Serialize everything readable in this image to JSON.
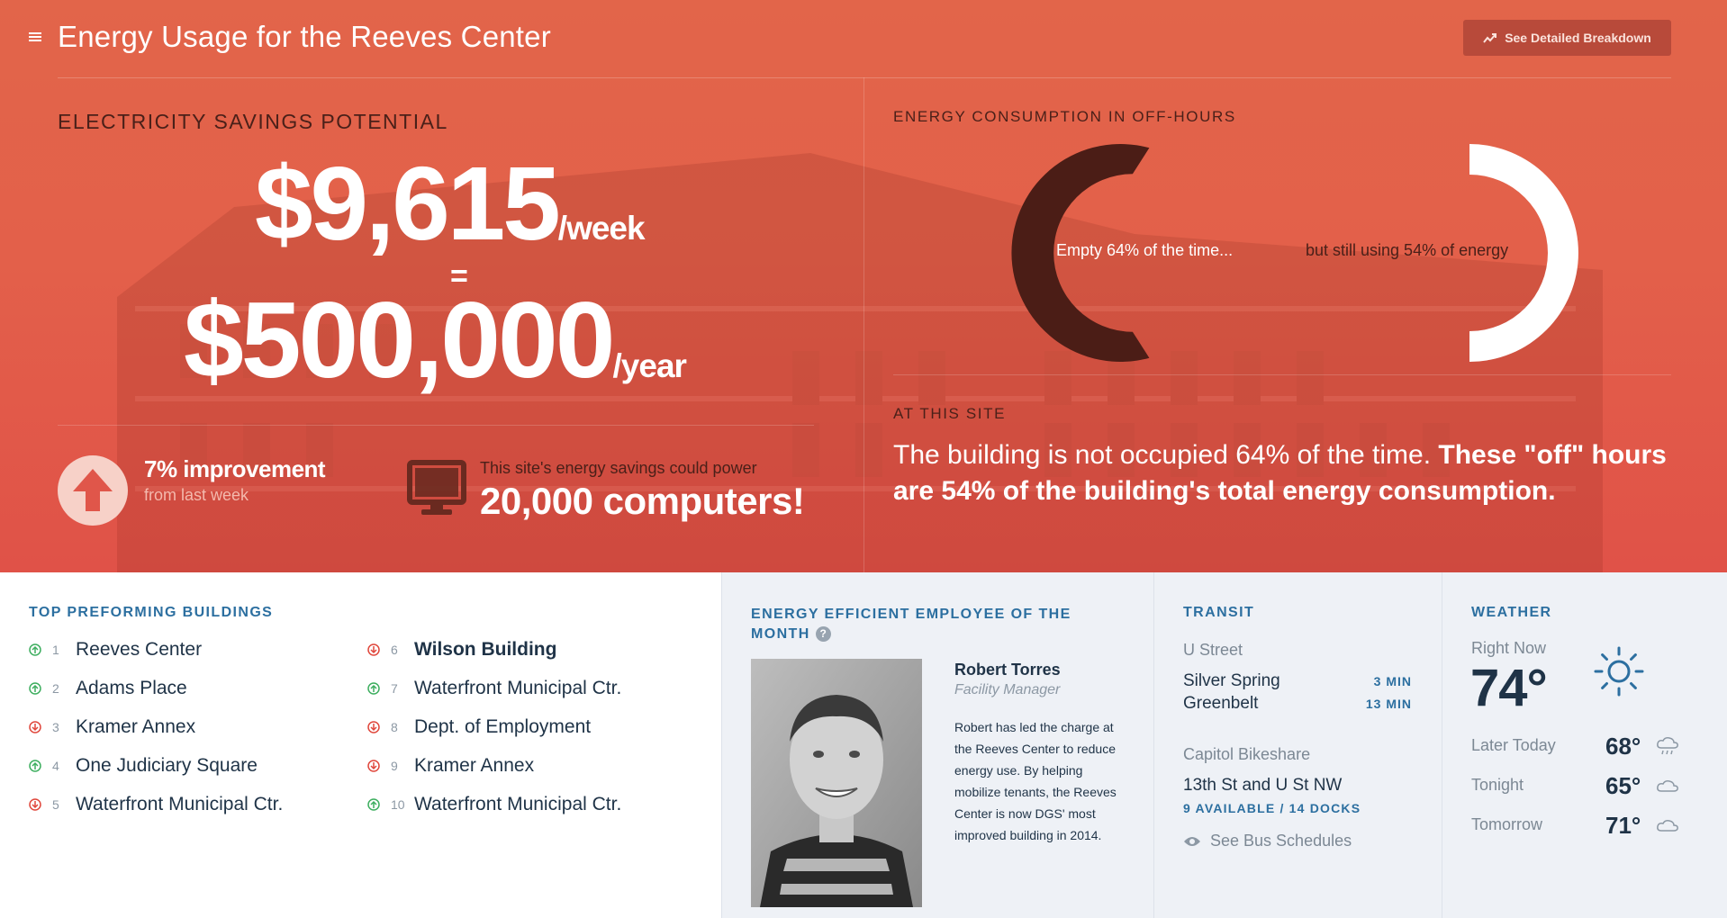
{
  "header": {
    "title": "Energy Usage for the Reeves Center",
    "breakdown_button": "See Detailed Breakdown",
    "menu_icon": "hamburger-menu-icon",
    "breakdown_icon": "trend-line-icon"
  },
  "savings": {
    "label": "ELECTRICITY SAVINGS POTENTIAL",
    "weekly_value": "$9,615",
    "weekly_unit": "/week",
    "equals": "=",
    "yearly_value": "$500,000",
    "yearly_unit": "/year",
    "improvement": "7% improvement",
    "improvement_sub": "from last week",
    "improvement_icon": "arrow-up-icon",
    "power_text": "This site's energy savings could power",
    "power_big": "20,000 computers!",
    "power_icon": "monitor-icon"
  },
  "consumption": {
    "label": "ENERGY CONSUMPTION IN OFF-HOURS",
    "empty_label": "Empty 64% of the time...",
    "using_label": "but still using 54% of energy",
    "empty_fraction": 0.64,
    "energy_fraction": 0.54
  },
  "site": {
    "label": "AT THIS SITE",
    "text_1": "The building is not occupied 64% of the time. ",
    "text_bold_1": "These \"off\" hours are 54%",
    "text_2": " of the building's total energy consumption.",
    "text_bold_2": ""
  },
  "buildings": {
    "title": "TOP PREFORMING BUILDINGS",
    "items": [
      {
        "rank": "1",
        "name": "Reeves Center",
        "trend": "up"
      },
      {
        "rank": "2",
        "name": "Adams Place",
        "trend": "up"
      },
      {
        "rank": "3",
        "name": "Kramer Annex",
        "trend": "down"
      },
      {
        "rank": "4",
        "name": "One Judiciary Square",
        "trend": "up"
      },
      {
        "rank": "5",
        "name": "Waterfront Municipal Ctr.",
        "trend": "down"
      },
      {
        "rank": "6",
        "name": "Wilson Building",
        "trend": "down"
      },
      {
        "rank": "7",
        "name": "Waterfront Municipal Ctr.",
        "trend": "up"
      },
      {
        "rank": "8",
        "name": "Dept. of Employment",
        "trend": "down"
      },
      {
        "rank": "9",
        "name": "Kramer Annex",
        "trend": "down"
      },
      {
        "rank": "10",
        "name": "Waterfront Municipal Ctr.",
        "trend": "up"
      }
    ]
  },
  "employee": {
    "title": "ENERGY EFFICIENT EMPLOYEE OF THE MONTH",
    "help": "?",
    "name": "Robert Torres",
    "role": "Facility Manager",
    "bio": "Robert has led the charge at the Reeves Center to reduce energy use. By helping mobilize tenants, the Reeves Center is now DGS' most improved building in 2014."
  },
  "transit": {
    "title": "TRANSIT",
    "metro_station": "U Street",
    "trains": [
      {
        "dest": "Silver Spring",
        "time": "3 MIN"
      },
      {
        "dest": "Greenbelt",
        "time": "13 MIN"
      }
    ],
    "bikeshare_label": "Capitol Bikeshare",
    "bikeshare_station": "13th St and U St NW",
    "bikeshare_docks": "9 AVAILABLE / 14 DOCKS",
    "bus_link": "See Bus Schedules",
    "bus_icon": "eye-icon"
  },
  "weather": {
    "title": "WEATHER",
    "now_label": "Right Now",
    "now_temp": "74°",
    "now_icon": "sun-icon",
    "forecast": [
      {
        "label": "Later Today",
        "temp": "68°",
        "icon": "rain-cloud-icon"
      },
      {
        "label": "Tonight",
        "temp": "65°",
        "icon": "cloud-icon"
      },
      {
        "label": "Tomorrow",
        "temp": "71°",
        "icon": "cloud-icon"
      }
    ]
  },
  "colors": {
    "hero_red": "#e3604a",
    "dark_brown": "#4a2019",
    "accent_blue": "#2c6fa0",
    "trend_up": "#3dae5f",
    "trend_down": "#e0473c"
  }
}
